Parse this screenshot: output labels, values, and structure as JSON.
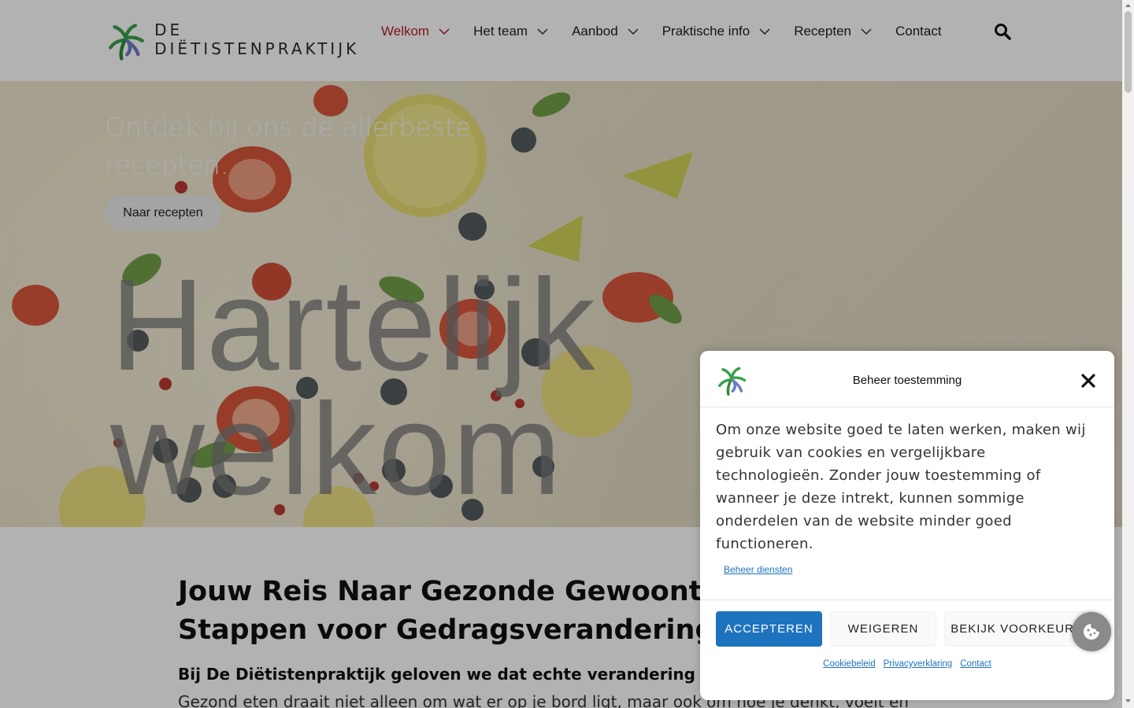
{
  "header": {
    "logo_text": "DE DIËTISTENPRAKTIJK",
    "nav": [
      {
        "label": "Welkom",
        "active": true,
        "has_submenu": true
      },
      {
        "label": "Het team",
        "has_submenu": true
      },
      {
        "label": "Aanbod",
        "has_submenu": true
      },
      {
        "label": "Praktische info",
        "has_submenu": true
      },
      {
        "label": "Recepten",
        "has_submenu": true
      },
      {
        "label": "Contact",
        "has_submenu": false
      }
    ],
    "search_icon": "search-icon"
  },
  "hero": {
    "subtitle": "Ontdek bij ons de allerbeste recepten.",
    "button_label": "Naar recepten",
    "title_line1": "Hartelijk",
    "title_line2": "welkom"
  },
  "main": {
    "heading": "Jouw Reis Naar Gezonde Gewoonten: Praktische Stappen voor Gedragsverandering",
    "lead": "Bij De Diëtistenpraktijk geloven we dat echte verandering",
    "body": "Gezond eten draait niet alleen om wat er op je bord ligt, maar ook om hoe je denkt, voelt en"
  },
  "cookie": {
    "title": "Beheer toestemming",
    "message": "Om onze website goed te laten werken, maken wij gebruik van cookies en vergelijkbare technologieën. Zonder jouw toestemming of wanneer je deze intrekt, kunnen sommige onderdelen van de website minder goed functioneren.",
    "manage_link": "Beheer diensten",
    "accept_label": "ACCEPTEREN",
    "deny_label": "WEIGEREN",
    "prefs_label": "BEKIJK VOORKEUREN",
    "links": [
      "Cookiebeleid",
      "Privacyverklaring",
      "Contact"
    ]
  },
  "colors": {
    "nav_active": "#b21e2d",
    "accent_blue": "#1e73be",
    "logo_green": "#3aa14a",
    "logo_blue": "#6c7fc4"
  }
}
